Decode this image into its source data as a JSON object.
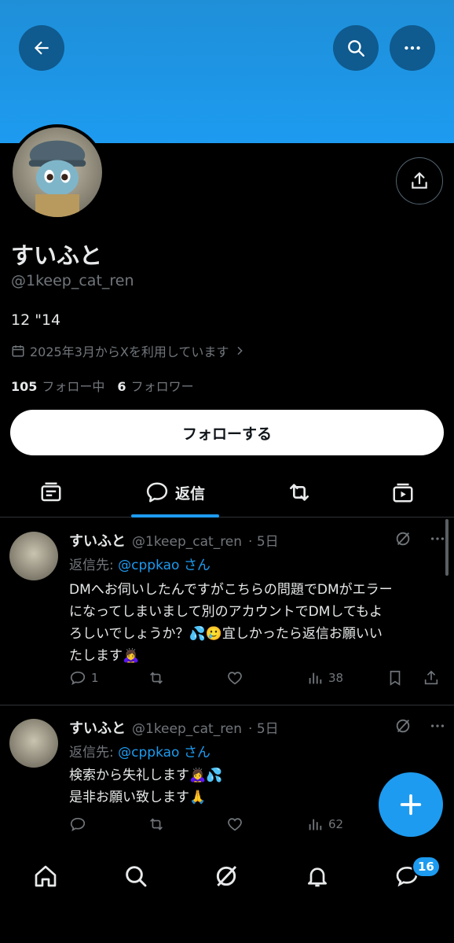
{
  "header": {
    "back_icon": "arrow-left-icon",
    "search_icon": "search-icon",
    "more_icon": "more-horizontal-icon"
  },
  "profile": {
    "name": "すいふと",
    "handle": "@1keep_cat_ren",
    "bio": "12 \"14",
    "joined": "2025年3月からXを利用しています",
    "following_count": "105",
    "following_label": "フォロー中",
    "followers_count": "6",
    "followers_label": "フォロワー",
    "follow_button": "フォローする"
  },
  "tabs": [
    {
      "icon": "posts-icon",
      "label": ""
    },
    {
      "icon": "reply-bubble-icon",
      "label": "返信",
      "active": true
    },
    {
      "icon": "retweet-icon",
      "label": ""
    },
    {
      "icon": "media-icon",
      "label": ""
    }
  ],
  "tweets": [
    {
      "name": "すいふと",
      "handle": "@1keep_cat_ren",
      "time": "· 5日",
      "reply_prefix": "返信先:",
      "reply_to": "@cppkao さん",
      "lines": [
        "DMへお伺いしたんですがこちらの問題でDMがエラー",
        "になってしまいまして別のアカウントでDMしてもよ",
        "ろしいでしょうか？💦🥲宜しかったら返信お願いい",
        "たします🙇‍♀️"
      ],
      "replies": "1",
      "retweets": "",
      "likes": "",
      "views": "38"
    },
    {
      "name": "すいふと",
      "handle": "@1keep_cat_ren",
      "time": "· 5日",
      "reply_prefix": "返信先:",
      "reply_to": "@cppkao さん",
      "lines": [
        "検索から失礼します🙇‍♀️💦",
        "是非お願い致します🙏"
      ],
      "replies": "",
      "retweets": "",
      "likes": "",
      "views": "62"
    }
  ],
  "fab": {
    "icon": "plus-icon"
  },
  "bottom_nav": {
    "items": [
      "home-icon",
      "search-icon",
      "grok-icon",
      "notifications-icon",
      "messages-icon"
    ],
    "messages_badge": "16"
  },
  "colors": {
    "banner": "#1d9bf0",
    "accent": "#1d9bf0",
    "muted": "#71767b",
    "text": "#e7e9ea",
    "background": "#000000"
  }
}
